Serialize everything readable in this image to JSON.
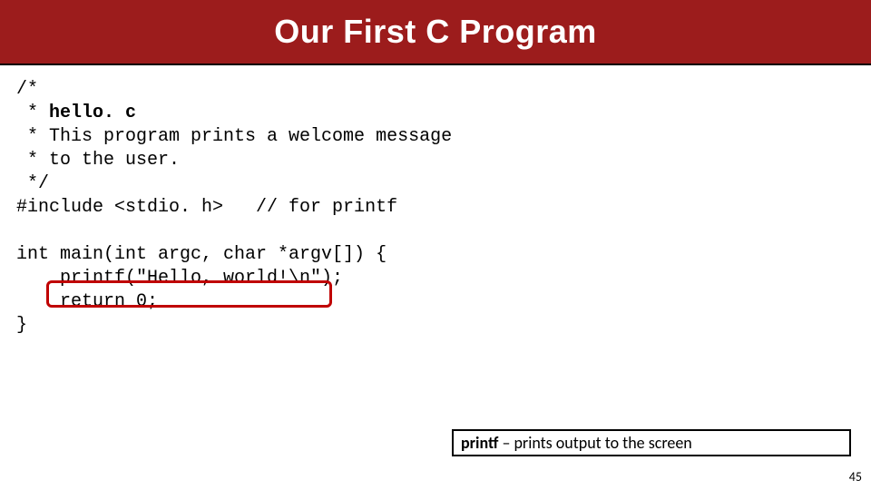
{
  "title": "Our First C Program",
  "code": {
    "l1": "/*",
    "l2a": " * ",
    "l2b": "hello. c",
    "l3": " * This program prints a welcome message",
    "l4": " * to the user.",
    "l5": " */",
    "l6": "#include <stdio. h>   // for printf",
    "l7": "",
    "l8": "int main(int argc, char *argv[]) {",
    "l9": "    printf(\"Hello, world!\\n\");",
    "l10": "    return 0;",
    "l11": "}"
  },
  "caption": {
    "bold": "printf",
    "rest": " – prints output to the screen"
  },
  "slide_number": "45"
}
